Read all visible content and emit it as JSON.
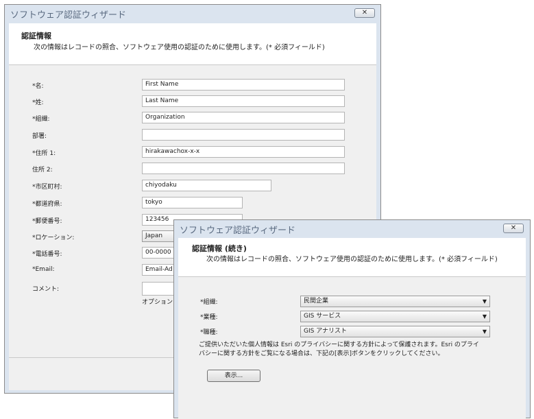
{
  "back_window": {
    "title": "ソフトウェア認証ウィザード",
    "close_glyph": "✕",
    "header_title": "認証情報",
    "header_subtitle": "次の情報はレコードの照合、ソフトウェア使用の認証のために使用します。(* 必須フィールド)",
    "fields": [
      {
        "label": "*名:",
        "value": "First Name"
      },
      {
        "label": "*姓:",
        "value": "Last Name"
      },
      {
        "label": "*組織:",
        "value": "Organization"
      },
      {
        "label": "部署:",
        "value": ""
      },
      {
        "label": "*住所 1:",
        "value": "hirakawachox-x-x"
      },
      {
        "label": "住所 2:",
        "value": ""
      },
      {
        "label": "*市区町村:",
        "value": "chiyodaku"
      },
      {
        "label": "*都道府県:",
        "value": "tokyo"
      },
      {
        "label": "*郵便番号:",
        "value": "123456"
      },
      {
        "label": "*ロケーション:",
        "value": "Japan"
      },
      {
        "label": "*電話番号:",
        "value": "00-0000"
      },
      {
        "label": "*Email:",
        "value": "Email-Ad"
      },
      {
        "label": "コメント:",
        "value": ""
      }
    ],
    "options_hint": "オプションと"
  },
  "front_window": {
    "title": "ソフトウェア認証ウィザード",
    "close_glyph": "✕",
    "header_title": "認証情報 (続き)",
    "header_subtitle": "次の情報はレコードの照合、ソフトウェア使用の認証のために使用します。(* 必須フィールド)",
    "fields": [
      {
        "label": "*組織:",
        "value": "民間企業"
      },
      {
        "label": "*業種:",
        "value": "GIS サービス"
      },
      {
        "label": "*職種:",
        "value": "GIS アナリスト"
      }
    ],
    "privacy_line1": "ご提供いただいた個人情報は Esri のプライバシーに関する方針によって保護されます。Esri のプライ",
    "privacy_line2": "バシーに関する方針をご覧になる場合は、下記の[表示]ボタンをクリックしてください。",
    "show_button": "表示..."
  }
}
